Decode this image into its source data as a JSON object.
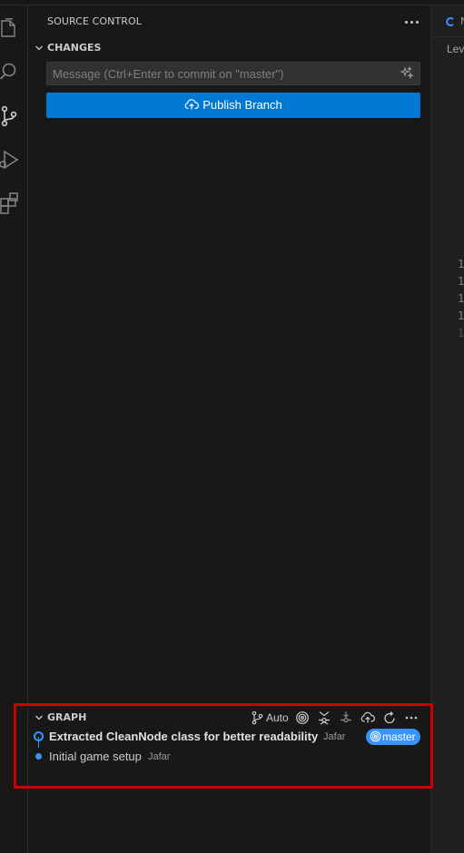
{
  "source_control": {
    "title": "SOURCE CONTROL",
    "changes": {
      "title": "CHANGES",
      "commit_placeholder": "Message (Ctrl+Enter to commit on \"master\")",
      "publish_label": "Publish Branch"
    },
    "graph": {
      "title": "GRAPH",
      "auto_label": "Auto",
      "commits": [
        {
          "message": "Extracted CleanNode class for better readability",
          "author": "Jafar",
          "branch": "master",
          "current": true
        },
        {
          "message": "Initial game setup",
          "author": "Jafar",
          "current": false
        }
      ]
    }
  },
  "editor": {
    "tab_label": "N",
    "breadcrumb": "Lev",
    "line_numbers": [
      "1",
      "1",
      "1",
      "1",
      "1"
    ]
  },
  "colors": {
    "accent": "#0078d4",
    "branch_badge": "#3794ff",
    "highlight": "#cc0000"
  },
  "icons": {
    "activity_bar": [
      "files-icon",
      "search-icon",
      "source-control-icon",
      "run-debug-icon",
      "extensions-icon"
    ]
  }
}
